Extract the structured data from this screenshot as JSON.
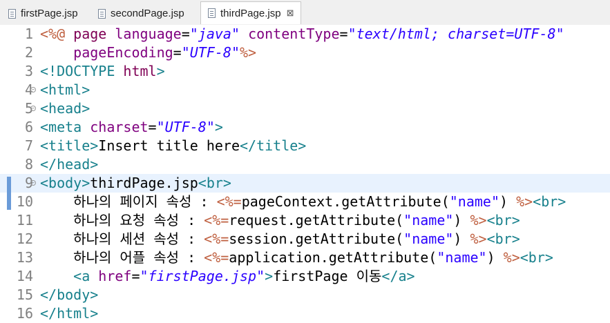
{
  "tabs": [
    {
      "label": "firstPage.jsp",
      "active": false
    },
    {
      "label": "secondPage.jsp",
      "active": false
    },
    {
      "label": "thirdPage.jsp",
      "active": true,
      "close": "⊠"
    }
  ],
  "colors": {
    "tag": "#17808c",
    "attribute": "#7f007f",
    "string": "#2a00ff",
    "jsp_delimiter": "#bf5f3f",
    "current_line": "#e8f2fe"
  },
  "lines": [
    {
      "n": "1",
      "t": [
        [
          "delim",
          "<%@ "
        ],
        [
          "kw",
          "page "
        ],
        [
          "attr",
          "language"
        ],
        [
          "plain",
          "="
        ],
        [
          "str",
          "\"java\""
        ],
        [
          "plain",
          " "
        ],
        [
          "attr",
          "contentType"
        ],
        [
          "plain",
          "="
        ],
        [
          "str",
          "\"text/html; charset=UTF-8\""
        ]
      ]
    },
    {
      "n": "2",
      "t": [
        [
          "plain",
          "    "
        ],
        [
          "attr",
          "pageEncoding"
        ],
        [
          "plain",
          "="
        ],
        [
          "str",
          "\"UTF-8\""
        ],
        [
          "delim",
          "%>"
        ]
      ]
    },
    {
      "n": "3",
      "t": [
        [
          "tag",
          "<!DOCTYPE "
        ],
        [
          "kw",
          "html"
        ],
        [
          "tag",
          ">"
        ]
      ]
    },
    {
      "n": "4",
      "fold": true,
      "t": [
        [
          "tag",
          "<html>"
        ]
      ]
    },
    {
      "n": "5",
      "fold": true,
      "t": [
        [
          "tag",
          "<head>"
        ]
      ]
    },
    {
      "n": "6",
      "t": [
        [
          "tag",
          "<meta "
        ],
        [
          "attr",
          "charset"
        ],
        [
          "plain",
          "="
        ],
        [
          "str",
          "\"UTF-8\""
        ],
        [
          "tag",
          ">"
        ]
      ]
    },
    {
      "n": "7",
      "t": [
        [
          "tag",
          "<title>"
        ],
        [
          "plain",
          "Insert title here"
        ],
        [
          "tag",
          "</title>"
        ]
      ]
    },
    {
      "n": "8",
      "t": [
        [
          "tag",
          "</head>"
        ]
      ]
    },
    {
      "n": "9",
      "fold": true,
      "current": true,
      "t": [
        [
          "tag",
          "<body>"
        ],
        [
          "plain",
          "thirdPage.jsp"
        ],
        [
          "tag",
          "<br>"
        ]
      ]
    },
    {
      "n": "10",
      "t": [
        [
          "plain",
          "    하나의 페이지 속성 : "
        ],
        [
          "delim",
          "<%="
        ],
        [
          "plain",
          "pageContext.getAttribute("
        ],
        [
          "jstr",
          "\"name\""
        ],
        [
          "plain",
          ") "
        ],
        [
          "delim",
          "%>"
        ],
        [
          "tag",
          "<br>"
        ]
      ]
    },
    {
      "n": "11",
      "t": [
        [
          "plain",
          "    하나의 요청 속성 : "
        ],
        [
          "delim",
          "<%="
        ],
        [
          "plain",
          "request.getAttribute("
        ],
        [
          "jstr",
          "\"name\""
        ],
        [
          "plain",
          ") "
        ],
        [
          "delim",
          "%>"
        ],
        [
          "tag",
          "<br>"
        ]
      ]
    },
    {
      "n": "12",
      "t": [
        [
          "plain",
          "    하나의 세션 속성 : "
        ],
        [
          "delim",
          "<%="
        ],
        [
          "plain",
          "session.getAttribute("
        ],
        [
          "jstr",
          "\"name\""
        ],
        [
          "plain",
          ") "
        ],
        [
          "delim",
          "%>"
        ],
        [
          "tag",
          "<br>"
        ]
      ]
    },
    {
      "n": "13",
      "t": [
        [
          "plain",
          "    하나의 어플 속성 : "
        ],
        [
          "delim",
          "<%="
        ],
        [
          "plain",
          "application.getAttribute("
        ],
        [
          "jstr",
          "\"name\""
        ],
        [
          "plain",
          ") "
        ],
        [
          "delim",
          "%>"
        ],
        [
          "tag",
          "<br>"
        ]
      ]
    },
    {
      "n": "14",
      "t": [
        [
          "plain",
          "    "
        ],
        [
          "tag",
          "<a "
        ],
        [
          "attr",
          "href"
        ],
        [
          "plain",
          "="
        ],
        [
          "str",
          "\"firstPage.jsp\""
        ],
        [
          "tag",
          ">"
        ],
        [
          "plain",
          "firstPage 이동"
        ],
        [
          "tag",
          "</a>"
        ]
      ]
    },
    {
      "n": "15",
      "t": [
        [
          "tag",
          "</body>"
        ]
      ]
    },
    {
      "n": "16",
      "t": [
        [
          "tag",
          "</html>"
        ]
      ]
    }
  ]
}
